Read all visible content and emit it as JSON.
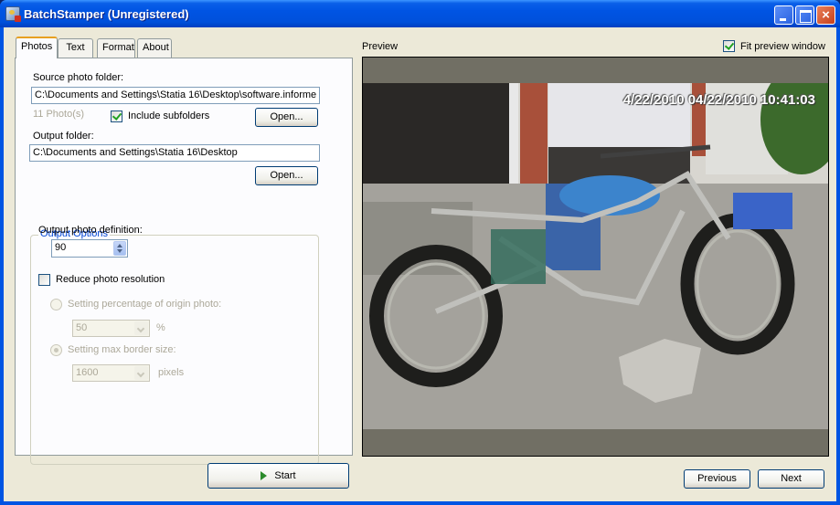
{
  "window": {
    "title": "BatchStamper (Unregistered)",
    "controls": {
      "minimize": "minimize-icon",
      "maximize": "maximize-icon",
      "close": "×"
    }
  },
  "tabs": [
    {
      "label": "Photos",
      "active": true
    },
    {
      "label": "Text",
      "active": false
    },
    {
      "label": "Format",
      "active": false
    },
    {
      "label": "About",
      "active": false
    }
  ],
  "photos": {
    "source_label": "Source photo folder:",
    "source_value": "C:\\Documents and Settings\\Statia 16\\Desktop\\software.informe",
    "photo_count": "11 Photo(s)",
    "include_subfolders_label": "Include subfolders",
    "include_subfolders_checked": true,
    "open_label": "Open...",
    "output_label": "Output folder:",
    "output_value": "C:\\Documents and Settings\\Statia 16\\Desktop",
    "open2_label": "Open..."
  },
  "output_options": {
    "title": "Output Options",
    "definition_label": "Output photo definition:",
    "definition_value": "90",
    "reduce_label": "Reduce photo resolution",
    "reduce_checked": false,
    "percentage_label": "Setting percentage of origin photo:",
    "percentage_value": "50",
    "percentage_unit": "%",
    "max_border_label": "Setting max border size:",
    "max_border_value": "1600",
    "max_border_unit": "pixels"
  },
  "preview": {
    "label": "Preview",
    "fit_label": "Fit preview window",
    "fit_checked": true,
    "stamp_text": "4/22/2010 04/22/2010 10:41:03",
    "image_desc": "Photo of a disassembled blue motorcycle frame on a driveway with engine on ground"
  },
  "footer": {
    "start_label": "Start",
    "previous_label": "Previous",
    "next_label": "Next"
  }
}
